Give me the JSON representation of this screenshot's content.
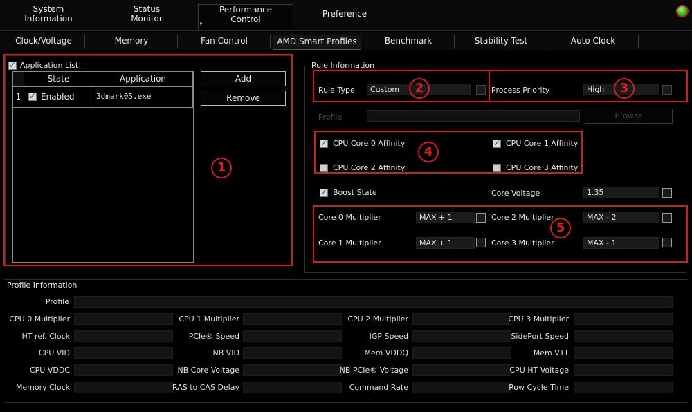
{
  "top_tabs": [
    {
      "line1": "System",
      "line2": "Information"
    },
    {
      "line1": "Status",
      "line2": "Monitor"
    },
    {
      "line1": "Performance",
      "line2": "Control"
    },
    {
      "line1": "Preference",
      "line2": ""
    }
  ],
  "sub_tabs": [
    "Clock/Voltage",
    "Memory",
    "Fan Control",
    "AMD Smart Profiles",
    "Benchmark",
    "Stability Test",
    "Auto Clock"
  ],
  "app_list": {
    "checkbox_label": "Application List",
    "headers": [
      "State",
      "Application"
    ],
    "rows": [
      {
        "index": "1",
        "state": "Enabled",
        "app": "3dmark05.exe"
      }
    ],
    "add_label": "Add",
    "remove_label": "Remove"
  },
  "rule": {
    "title": "Rule Information",
    "rule_type_label": "Rule Type",
    "rule_type_value": "Custom",
    "priority_label": "Process Priority",
    "priority_value": "High",
    "profile_label": "Profile",
    "browse_label": "Browse",
    "affinity": [
      "CPU Core 0 Affinity",
      "CPU Core 1 Affinity",
      "CPU Core 2 Affinity",
      "CPU Core 3 Affinity"
    ],
    "affinity_checked": [
      true,
      true,
      false,
      false
    ],
    "boost_label": "Boost State",
    "core_voltage_label": "Core Voltage",
    "core_voltage_value": "1.35",
    "multipliers": [
      {
        "label": "Core 0 Multiplier",
        "value": "MAX + 1"
      },
      {
        "label": "Core 1 Multiplier",
        "value": "MAX + 1"
      },
      {
        "label": "Core 2 Multiplier",
        "value": "MAX - 2"
      },
      {
        "label": "Core 3 Multiplier",
        "value": "MAX - 1"
      }
    ]
  },
  "annotations": [
    "1",
    "2",
    "3",
    "4",
    "5"
  ],
  "profile_info": {
    "title": "Profile Information",
    "profile_label": "Profile",
    "rows": [
      [
        "CPU 0 Multiplier",
        "CPU 1 Multiplier",
        "CPU 2 Multiplier",
        "CPU 3 Multiplier"
      ],
      [
        "HT ref. Clock",
        "PCIe® Speed",
        "IGP Speed",
        "SidePort Speed"
      ],
      [
        "CPU VID",
        "NB VID",
        "Mem VDDQ",
        "Mem VTT"
      ],
      [
        "CPU VDDC",
        "NB Core Voltage",
        "NB PCIe® Voltage",
        "CPU HT Voltage"
      ],
      [
        "Memory Clock",
        "RAS to CAS Delay",
        "Command Rate",
        "Row Cycle Time"
      ]
    ]
  },
  "colors": {
    "annotation_red": "#d41e1e",
    "status_green": "#2fc61a",
    "background": "#000000"
  }
}
